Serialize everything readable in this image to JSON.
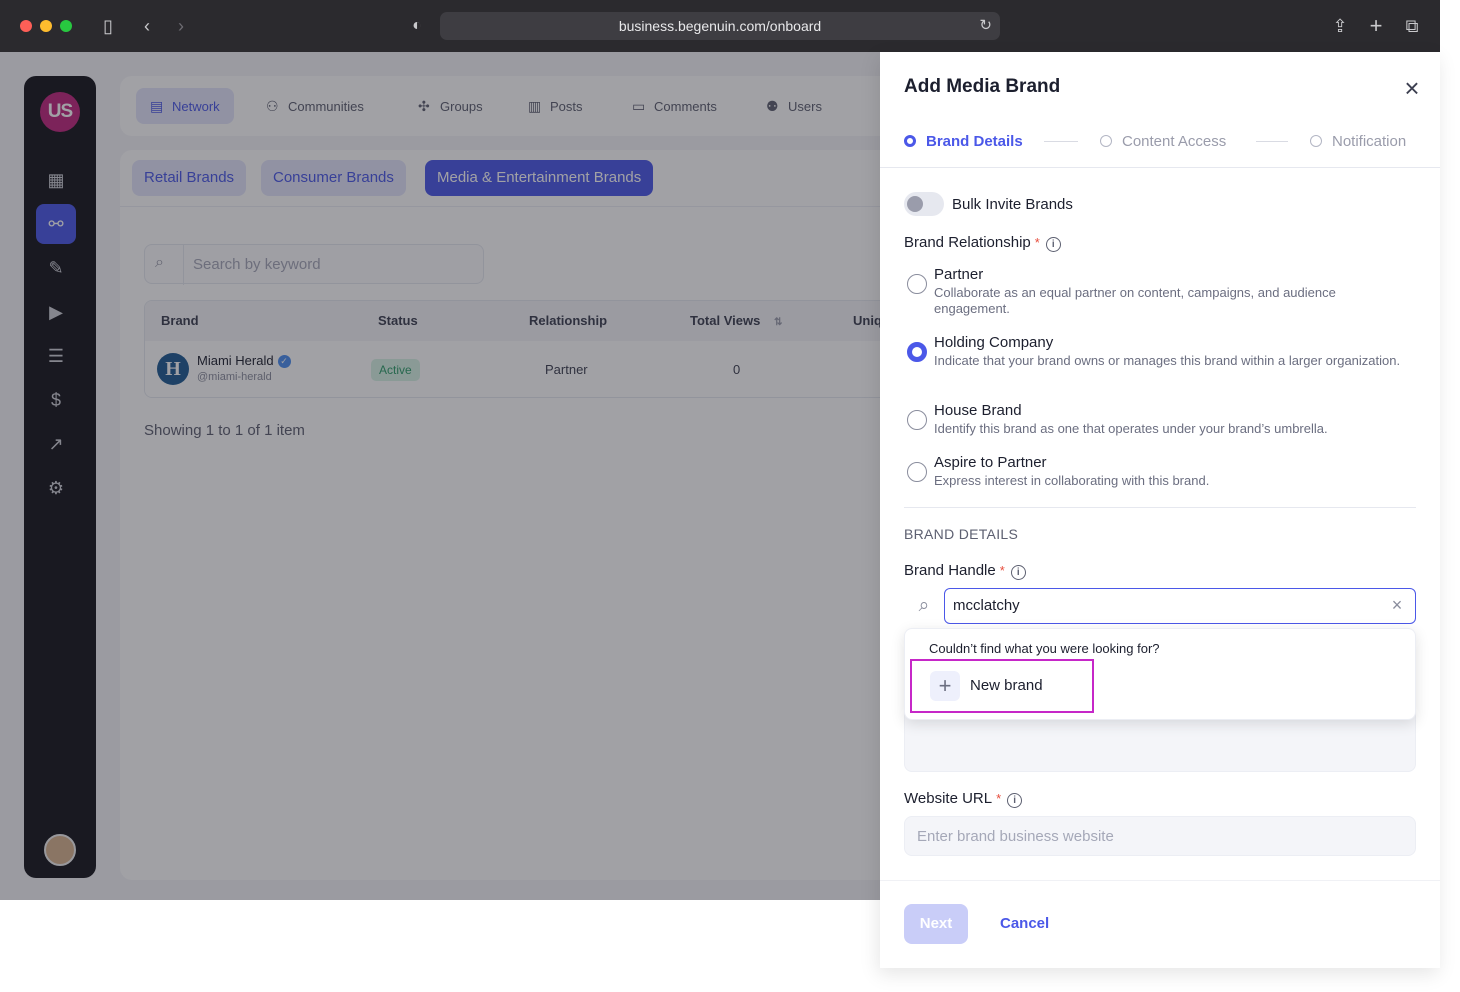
{
  "browser": {
    "url": "business.begenuin.com/onboard"
  },
  "sidebar": {
    "logo_text": "US",
    "items": [
      {
        "name": "dashboard-icon",
        "glyph": "▦"
      },
      {
        "name": "network-icon",
        "glyph": "⚯"
      },
      {
        "name": "magic-wand-icon",
        "glyph": "✎"
      },
      {
        "name": "content-icon",
        "glyph": "▶"
      },
      {
        "name": "list-icon",
        "glyph": "☰"
      },
      {
        "name": "dollar-icon",
        "glyph": "$"
      },
      {
        "name": "analytics-icon",
        "glyph": "↗"
      },
      {
        "name": "settings-icon",
        "glyph": "⚙"
      }
    ]
  },
  "topnav": {
    "items": [
      "Network",
      "Communities",
      "Groups",
      "Posts",
      "Comments",
      "Users"
    ]
  },
  "brand_tabs": [
    "Retail Brands",
    "Consumer Brands",
    "Media & Entertainment Brands"
  ],
  "table": {
    "search_placeholder": "Search by keyword",
    "headers": [
      "Brand",
      "Status",
      "Relationship",
      "Total Views",
      "Uniq"
    ],
    "rows": [
      {
        "brand": "Miami Herald",
        "handle": "@miami-herald",
        "status": "Active",
        "relationship": "Partner",
        "total_views": "0"
      }
    ],
    "showing": "Showing 1 to 1 of 1 item"
  },
  "drawer": {
    "title": "Add Media Brand",
    "steps": [
      "Brand Details",
      "Content Access",
      "Notification"
    ],
    "bulk_invite_label": "Bulk Invite Brands",
    "relationship_label": "Brand Relationship",
    "required_mark": "*",
    "options": [
      {
        "title": "Partner",
        "desc": "Collaborate as an equal partner on content, campaigns, and audience engagement."
      },
      {
        "title": "Holding Company",
        "desc": "Indicate that your brand owns or manages this brand within a larger organization."
      },
      {
        "title": "House Brand",
        "desc": "Identify this brand as one that operates under your brand’s umbrella."
      },
      {
        "title": "Aspire to Partner",
        "desc": "Express interest in collaborating with this brand."
      }
    ],
    "selected_option": "Holding Company",
    "section_heading": "BRAND DETAILS",
    "handle_label": "Brand Handle",
    "handle_value": "mcclatchy",
    "dropdown_text": "Couldn’t find what you were looking for?",
    "new_brand_label": "New brand",
    "website_label": "Website URL",
    "website_placeholder": "Enter brand business website",
    "next_label": "Next",
    "cancel_label": "Cancel"
  },
  "colors": {
    "accent": "#4b58e8",
    "highlight": "#c627c8",
    "status_active": "#2e9d6a"
  }
}
